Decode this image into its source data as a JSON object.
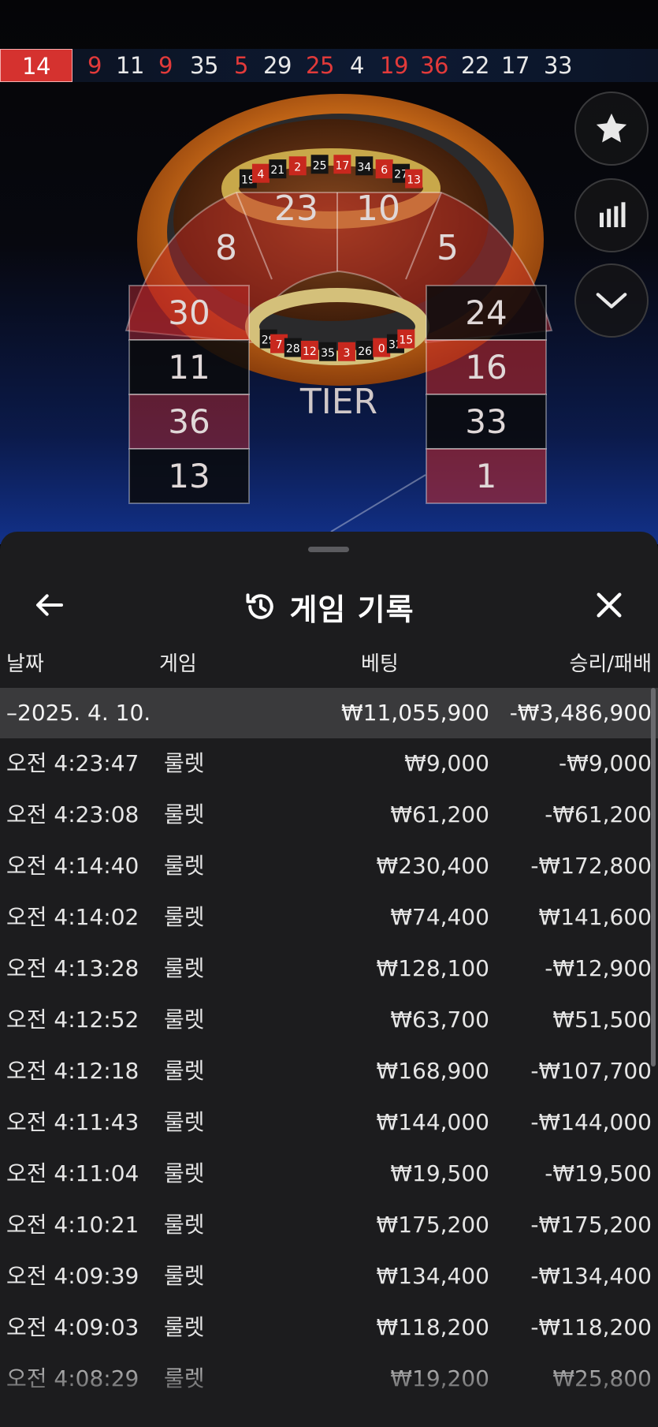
{
  "history": {
    "numbers": [
      {
        "value": "14",
        "color": "#ffffff",
        "highlight": true
      },
      {
        "value": "9",
        "color": "#e23a3a"
      },
      {
        "value": "11",
        "color": "#e8e8e8"
      },
      {
        "value": "9",
        "color": "#e23a3a"
      },
      {
        "value": "35",
        "color": "#e8e8e8"
      },
      {
        "value": "5",
        "color": "#e23a3a"
      },
      {
        "value": "29",
        "color": "#e8e8e8"
      },
      {
        "value": "25",
        "color": "#e23a3a"
      },
      {
        "value": "4",
        "color": "#e8e8e8"
      },
      {
        "value": "19",
        "color": "#e23a3a"
      },
      {
        "value": "36",
        "color": "#e23a3a"
      },
      {
        "value": "22",
        "color": "#e8e8e8"
      },
      {
        "value": "17",
        "color": "#e8e8e8"
      },
      {
        "value": "33",
        "color": "#e8e8e8"
      }
    ]
  },
  "racetrack": {
    "center_labels": [
      "23",
      "10",
      "8",
      "5"
    ],
    "left_column": [
      "30",
      "11",
      "36",
      "13"
    ],
    "right_column": [
      "24",
      "16",
      "33",
      "1"
    ],
    "tier_label": "TIER",
    "wheel_numbers_top": [
      "19",
      "4",
      "21",
      "2",
      "25",
      "17",
      "34",
      "6",
      "27",
      "13"
    ],
    "wheel_numbers_bottom": [
      "29",
      "7",
      "28",
      "12",
      "35",
      "3",
      "26",
      "0",
      "32",
      "15"
    ]
  },
  "side_buttons": {
    "favorite_icon": "star-icon",
    "stats_icon": "bar-chart-icon",
    "collapse_icon": "chevron-down-icon"
  },
  "sheet": {
    "title": "게임 기록",
    "title_icon": "history-icon",
    "back_icon": "back-arrow-icon",
    "close_icon": "close-icon"
  },
  "columns": {
    "date": "날짜",
    "game": "게임",
    "bet": "베팅",
    "result": "승리/패배"
  },
  "summary_row": {
    "date": "–2025. 4. 10.",
    "bet": "₩11,055,900",
    "result": "-₩3,486,900"
  },
  "rows": [
    {
      "time": "오전 4:23:47",
      "game": "룰렛",
      "bet": "₩9,000",
      "result": "-₩9,000"
    },
    {
      "time": "오전 4:23:08",
      "game": "룰렛",
      "bet": "₩61,200",
      "result": "-₩61,200"
    },
    {
      "time": "오전 4:14:40",
      "game": "룰렛",
      "bet": "₩230,400",
      "result": "-₩172,800"
    },
    {
      "time": "오전 4:14:02",
      "game": "룰렛",
      "bet": "₩74,400",
      "result": "₩141,600"
    },
    {
      "time": "오전 4:13:28",
      "game": "룰렛",
      "bet": "₩128,100",
      "result": "-₩12,900"
    },
    {
      "time": "오전 4:12:52",
      "game": "룰렛",
      "bet": "₩63,700",
      "result": "₩51,500"
    },
    {
      "time": "오전 4:12:18",
      "game": "룰렛",
      "bet": "₩168,900",
      "result": "-₩107,700"
    },
    {
      "time": "오전 4:11:43",
      "game": "룰렛",
      "bet": "₩144,000",
      "result": "-₩144,000"
    },
    {
      "time": "오전 4:11:04",
      "game": "룰렛",
      "bet": "₩19,500",
      "result": "-₩19,500"
    },
    {
      "time": "오전 4:10:21",
      "game": "룰렛",
      "bet": "₩175,200",
      "result": "-₩175,200"
    },
    {
      "time": "오전 4:09:39",
      "game": "룰렛",
      "bet": "₩134,400",
      "result": "-₩134,400"
    },
    {
      "time": "오전 4:09:03",
      "game": "룰렛",
      "bet": "₩118,200",
      "result": "-₩118,200"
    },
    {
      "time": "오전 4:08:29",
      "game": "룰렛",
      "bet": "₩19,200",
      "result": "₩25,800"
    }
  ],
  "colors": {
    "red": "#d5322f",
    "sheet_bg": "#1c1c1e",
    "summary_bg": "#3a3a3c"
  }
}
